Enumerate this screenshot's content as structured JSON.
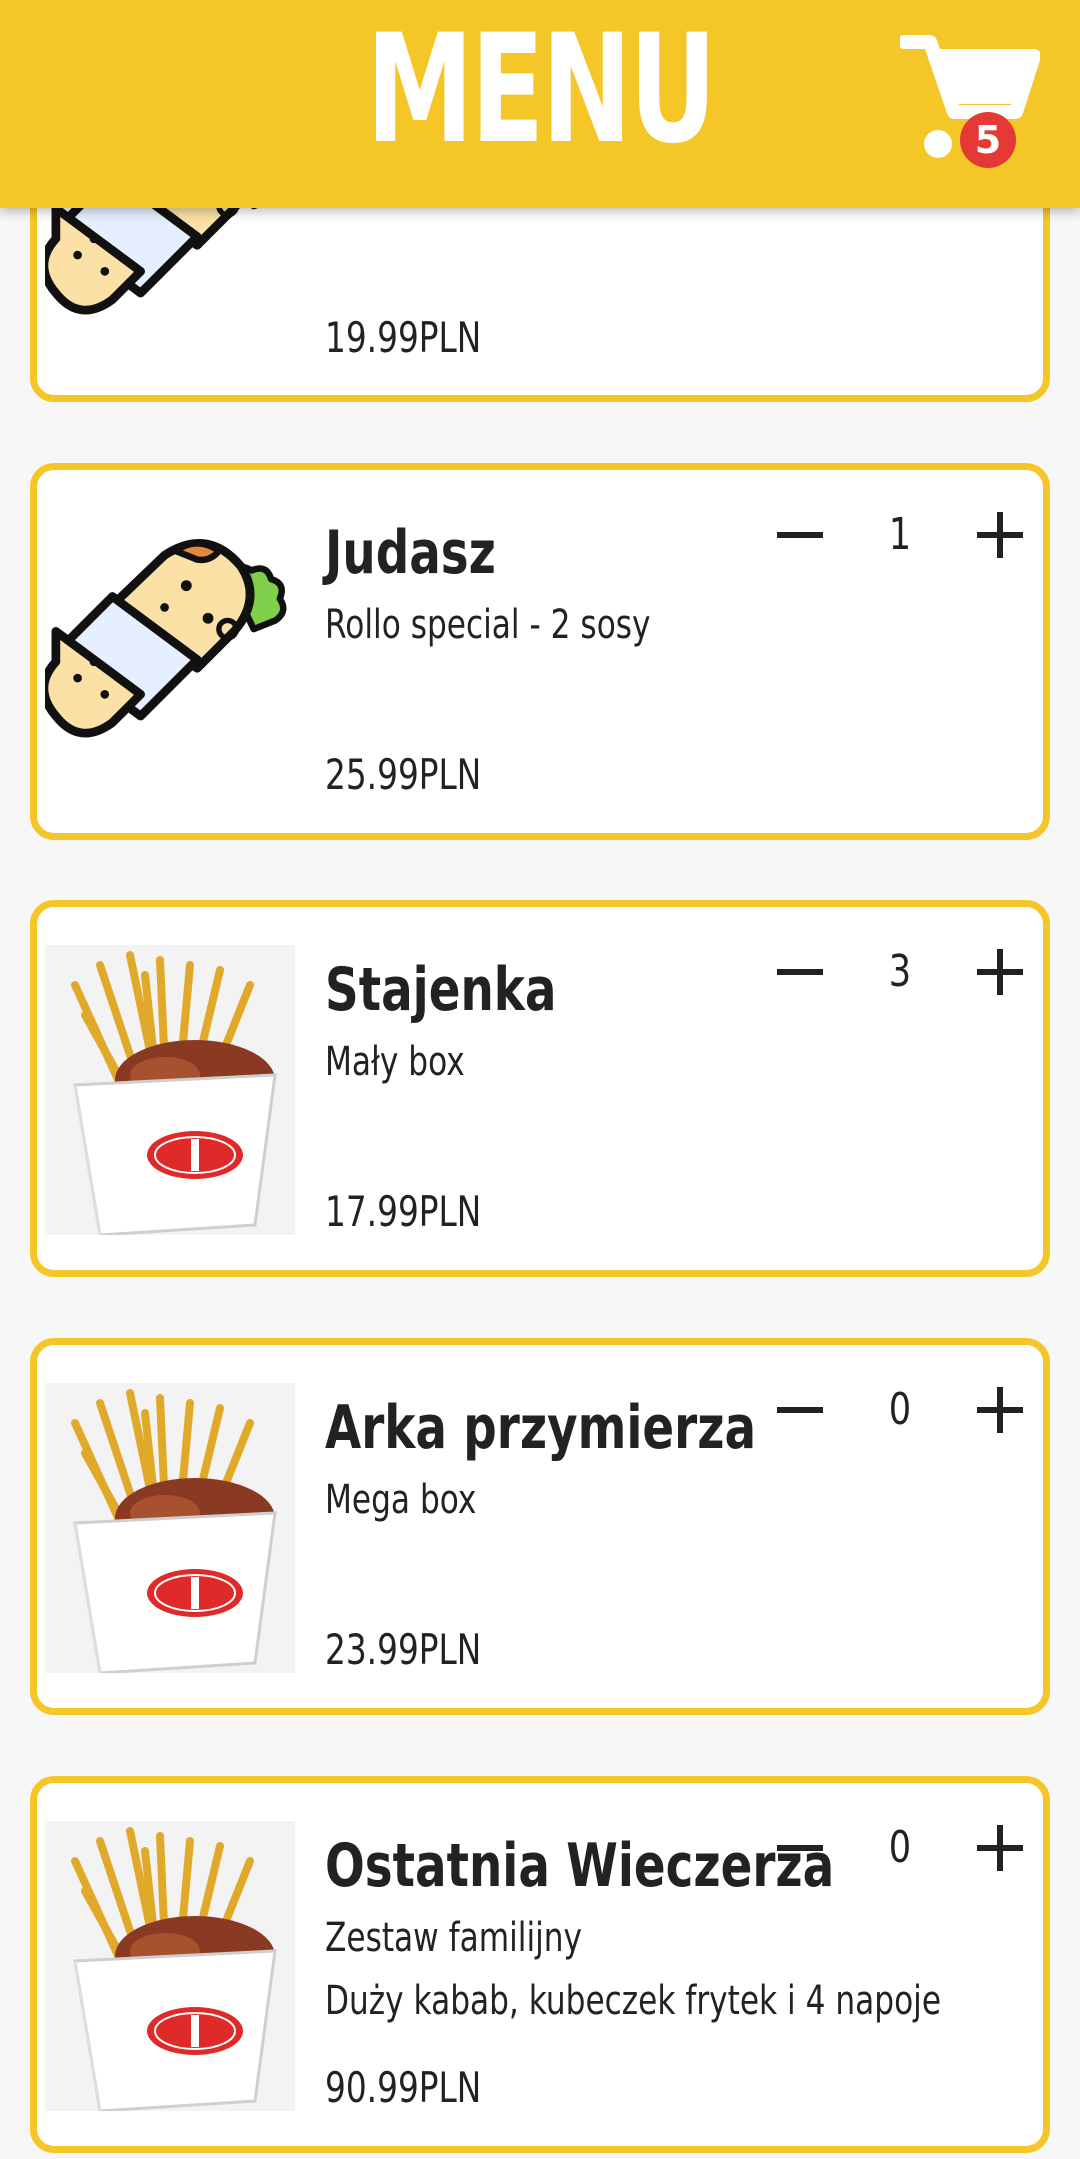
{
  "header": {
    "title": "MENU",
    "cart_count": "5"
  },
  "items": [
    {
      "name": "",
      "desc": "",
      "price": "19.99PLN",
      "qty": "",
      "image": "wrap-icon"
    },
    {
      "name": "Judasz",
      "desc": "Rollo special - 2 sosy",
      "price": "25.99PLN",
      "qty": "1",
      "image": "wrap-icon"
    },
    {
      "name": "Stajenka",
      "desc": "Mały box",
      "price": "17.99PLN",
      "qty": "3",
      "image": "kebab-box-photo"
    },
    {
      "name": "Arka przymierza",
      "desc": "Mega box",
      "price": "23.99PLN",
      "qty": "0",
      "image": "kebab-box-photo"
    },
    {
      "name": "Ostatnia Wieczerza",
      "desc": "Zestaw familijny",
      "desc2": "Duży kabab, kubeczek frytek i 4 napoje",
      "price": "90.99PLN",
      "qty": "0",
      "image": "kebab-box-photo"
    }
  ],
  "colors": {
    "accent": "#f5c628",
    "badge": "#e53935",
    "background": "#f7f7f7"
  }
}
